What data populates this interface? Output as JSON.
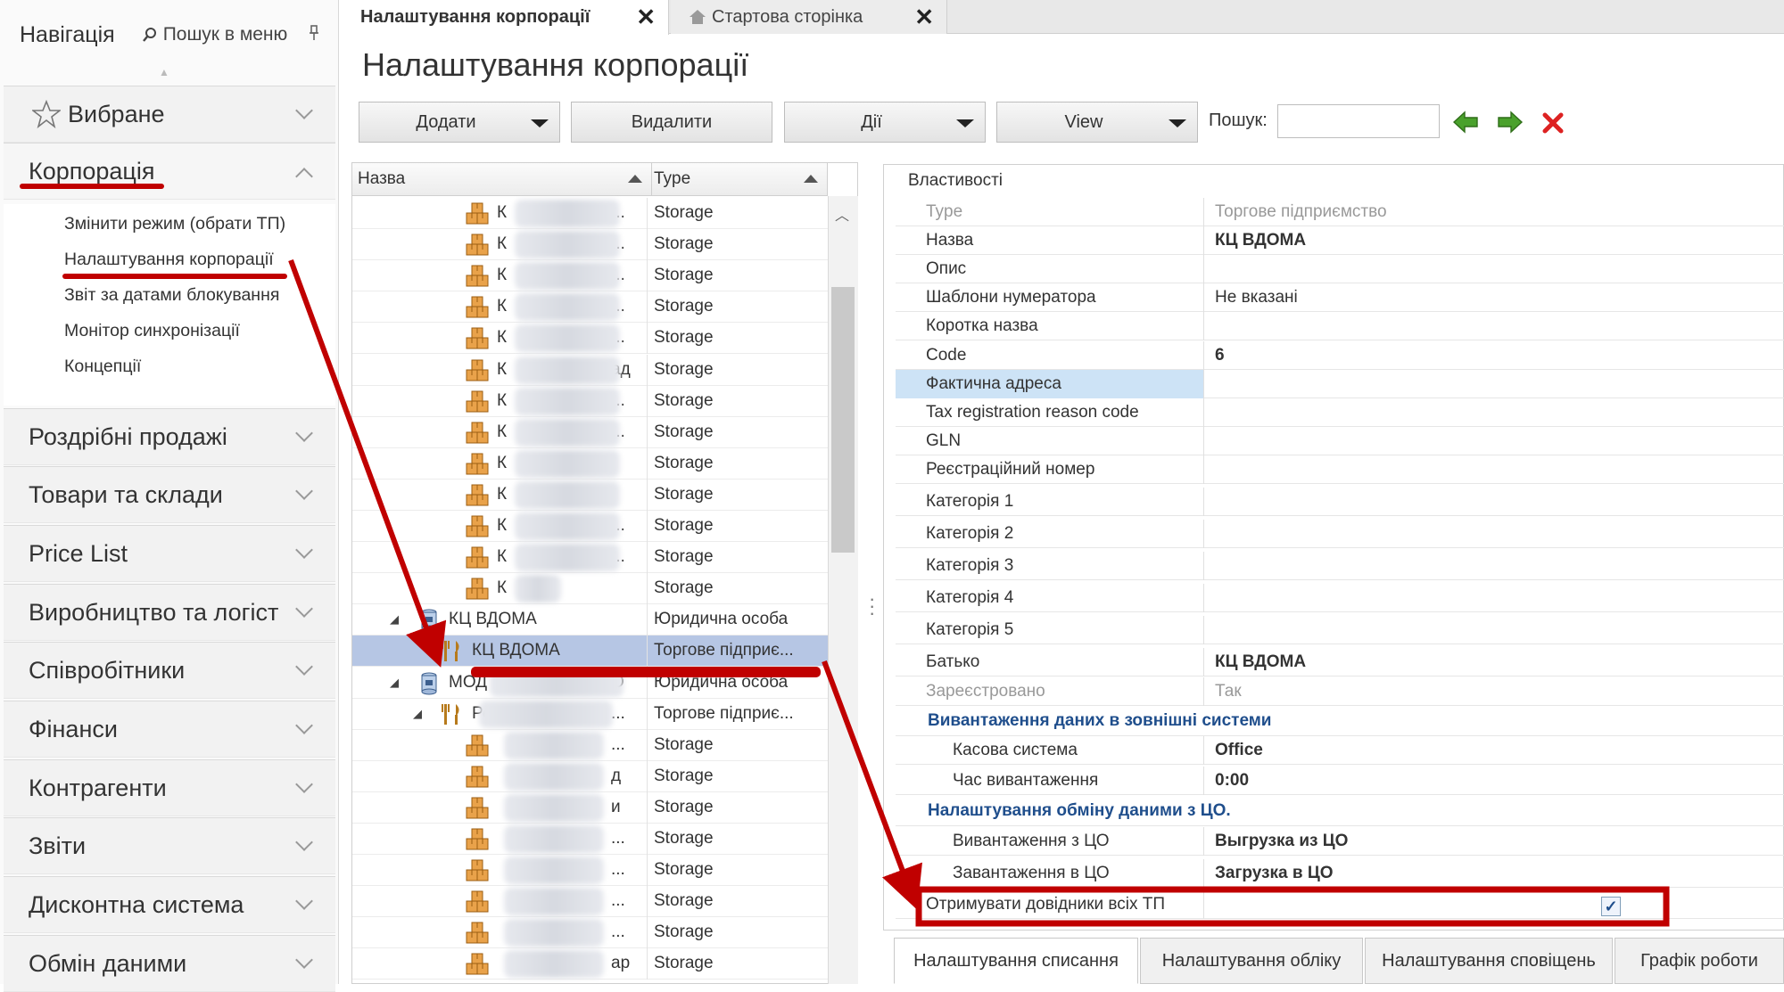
{
  "nav": {
    "title": "Навігація",
    "search_label": "Пошук в меню",
    "groups": [
      {
        "label": "Вибране"
      },
      {
        "label": "Корпорація"
      },
      {
        "label": "Роздрібні продажі"
      },
      {
        "label": "Товари та склади"
      },
      {
        "label": "Price List"
      },
      {
        "label": "Виробництво та логіст"
      },
      {
        "label": "Співробітники"
      },
      {
        "label": "Фінанси"
      },
      {
        "label": "Контрагенти"
      },
      {
        "label": "Звіти"
      },
      {
        "label": "Дисконтна система"
      },
      {
        "label": "Обмін даними"
      }
    ],
    "corp_items": [
      "Змінити режим (обрати ТП)",
      "Налаштування корпорації",
      "Звіт за датами блокування",
      "Монітор синхронізації",
      "Концепції"
    ]
  },
  "tabs": [
    {
      "label": "Налаштування корпорації",
      "close": "✕"
    },
    {
      "label": "Стартова сторінка",
      "close": "✕"
    }
  ],
  "page_title": "Налаштування корпорації",
  "toolbar": {
    "add": "Додати",
    "delete": "Видалити",
    "actions": "Дії",
    "view": "View",
    "search_label": "Пошук:",
    "search_value": ""
  },
  "tree": {
    "columns": [
      "Назва",
      "Type"
    ],
    "rows": [
      {
        "name": "К",
        "tail": "...",
        "type": "Storage"
      },
      {
        "name": "К",
        "tail": "...",
        "type": "Storage"
      },
      {
        "name": "К",
        "tail": "...",
        "type": "Storage"
      },
      {
        "name": "К",
        "tail": "...",
        "type": "Storage"
      },
      {
        "name": "К",
        "tail": "...",
        "type": "Storage"
      },
      {
        "name": "К",
        "tail": "ад",
        "type": "Storage"
      },
      {
        "name": "К",
        "tail": "...",
        "type": "Storage"
      },
      {
        "name": "К",
        "tail": "...",
        "type": "Storage"
      },
      {
        "name": "К",
        "tail": "",
        "type": "Storage"
      },
      {
        "name": "К",
        "tail": "",
        "type": "Storage"
      },
      {
        "name": "К",
        "tail": "...",
        "type": "Storage"
      },
      {
        "name": "К",
        "tail": "...",
        "type": "Storage"
      },
      {
        "name": "К",
        "tail": "",
        "type": "Storage"
      },
      {
        "name": "КЦ ВДОМА",
        "tail": "",
        "type": "Юридична особа"
      },
      {
        "name": "КЦ ВДОМА",
        "tail": "",
        "type": "Торгове підприє..."
      },
      {
        "name": "МОД",
        "tail": "О",
        "type": "Юридична особа"
      },
      {
        "name": "Рест",
        "tail": "...",
        "type": "Торгове підприє..."
      },
      {
        "name": "",
        "tail": "...",
        "type": "Storage"
      },
      {
        "name": "",
        "tail": "д",
        "type": "Storage"
      },
      {
        "name": "",
        "tail": "и",
        "type": "Storage"
      },
      {
        "name": "",
        "tail": "...",
        "type": "Storage"
      },
      {
        "name": "",
        "tail": "...",
        "type": "Storage"
      },
      {
        "name": "",
        "tail": "...",
        "type": "Storage"
      },
      {
        "name": "",
        "tail": "...",
        "type": "Storage"
      },
      {
        "name": "",
        "tail": "ар",
        "type": "Storage"
      }
    ]
  },
  "props": {
    "legend": "Властивості",
    "rows": [
      {
        "key": "Type",
        "value": "Торгове підприємство"
      },
      {
        "key": "Назва",
        "value": "КЦ ВДОМА"
      },
      {
        "key": "Опис",
        "value": ""
      },
      {
        "key": "Шаблони нумератора",
        "value": "Не вказані"
      },
      {
        "key": "Коротка назва",
        "value": ""
      },
      {
        "key": "Code",
        "value": "6"
      },
      {
        "key": "Фактична адреса",
        "value": ""
      },
      {
        "key": "Tax registration reason code",
        "value": ""
      },
      {
        "key": "GLN",
        "value": ""
      },
      {
        "key": "Реєстраційний номер",
        "value": ""
      },
      {
        "key": "Категорія 1",
        "value": ""
      },
      {
        "key": "Категорія 2",
        "value": ""
      },
      {
        "key": "Категорія 3",
        "value": ""
      },
      {
        "key": "Категорія 4",
        "value": ""
      },
      {
        "key": "Категорія 5",
        "value": ""
      },
      {
        "key": "Батько",
        "value": "КЦ ВДОМА"
      },
      {
        "key": "Зареєстровано",
        "value": "Так"
      }
    ],
    "cat1": "Вивантаження даних в зовнішні системи",
    "cat1_rows": [
      {
        "key": "Касова система",
        "value": "Office"
      },
      {
        "key": "Час вивантаження",
        "value": "0:00"
      }
    ],
    "cat2": "Налаштування обміну даними з ЦО.",
    "cat2_rows": [
      {
        "key": "Вивантаження з ЦО",
        "value": "Выгрузка из ЦО"
      },
      {
        "key": "Завантаження в ЦО",
        "value": "Загрузка в ЦО"
      }
    ],
    "last_row": {
      "key": "Отримувати довідники всіх ТП",
      "checked": true,
      "check": "✓"
    }
  },
  "bottom_tabs": [
    "Налаштування списання",
    "Налаштування обліку",
    "Налаштування сповіщень",
    "Графік роботи"
  ],
  "colors": {
    "annotation_red": "#c00000",
    "selection": "#b6c6e4",
    "category_blue": "#1f4e8c"
  }
}
